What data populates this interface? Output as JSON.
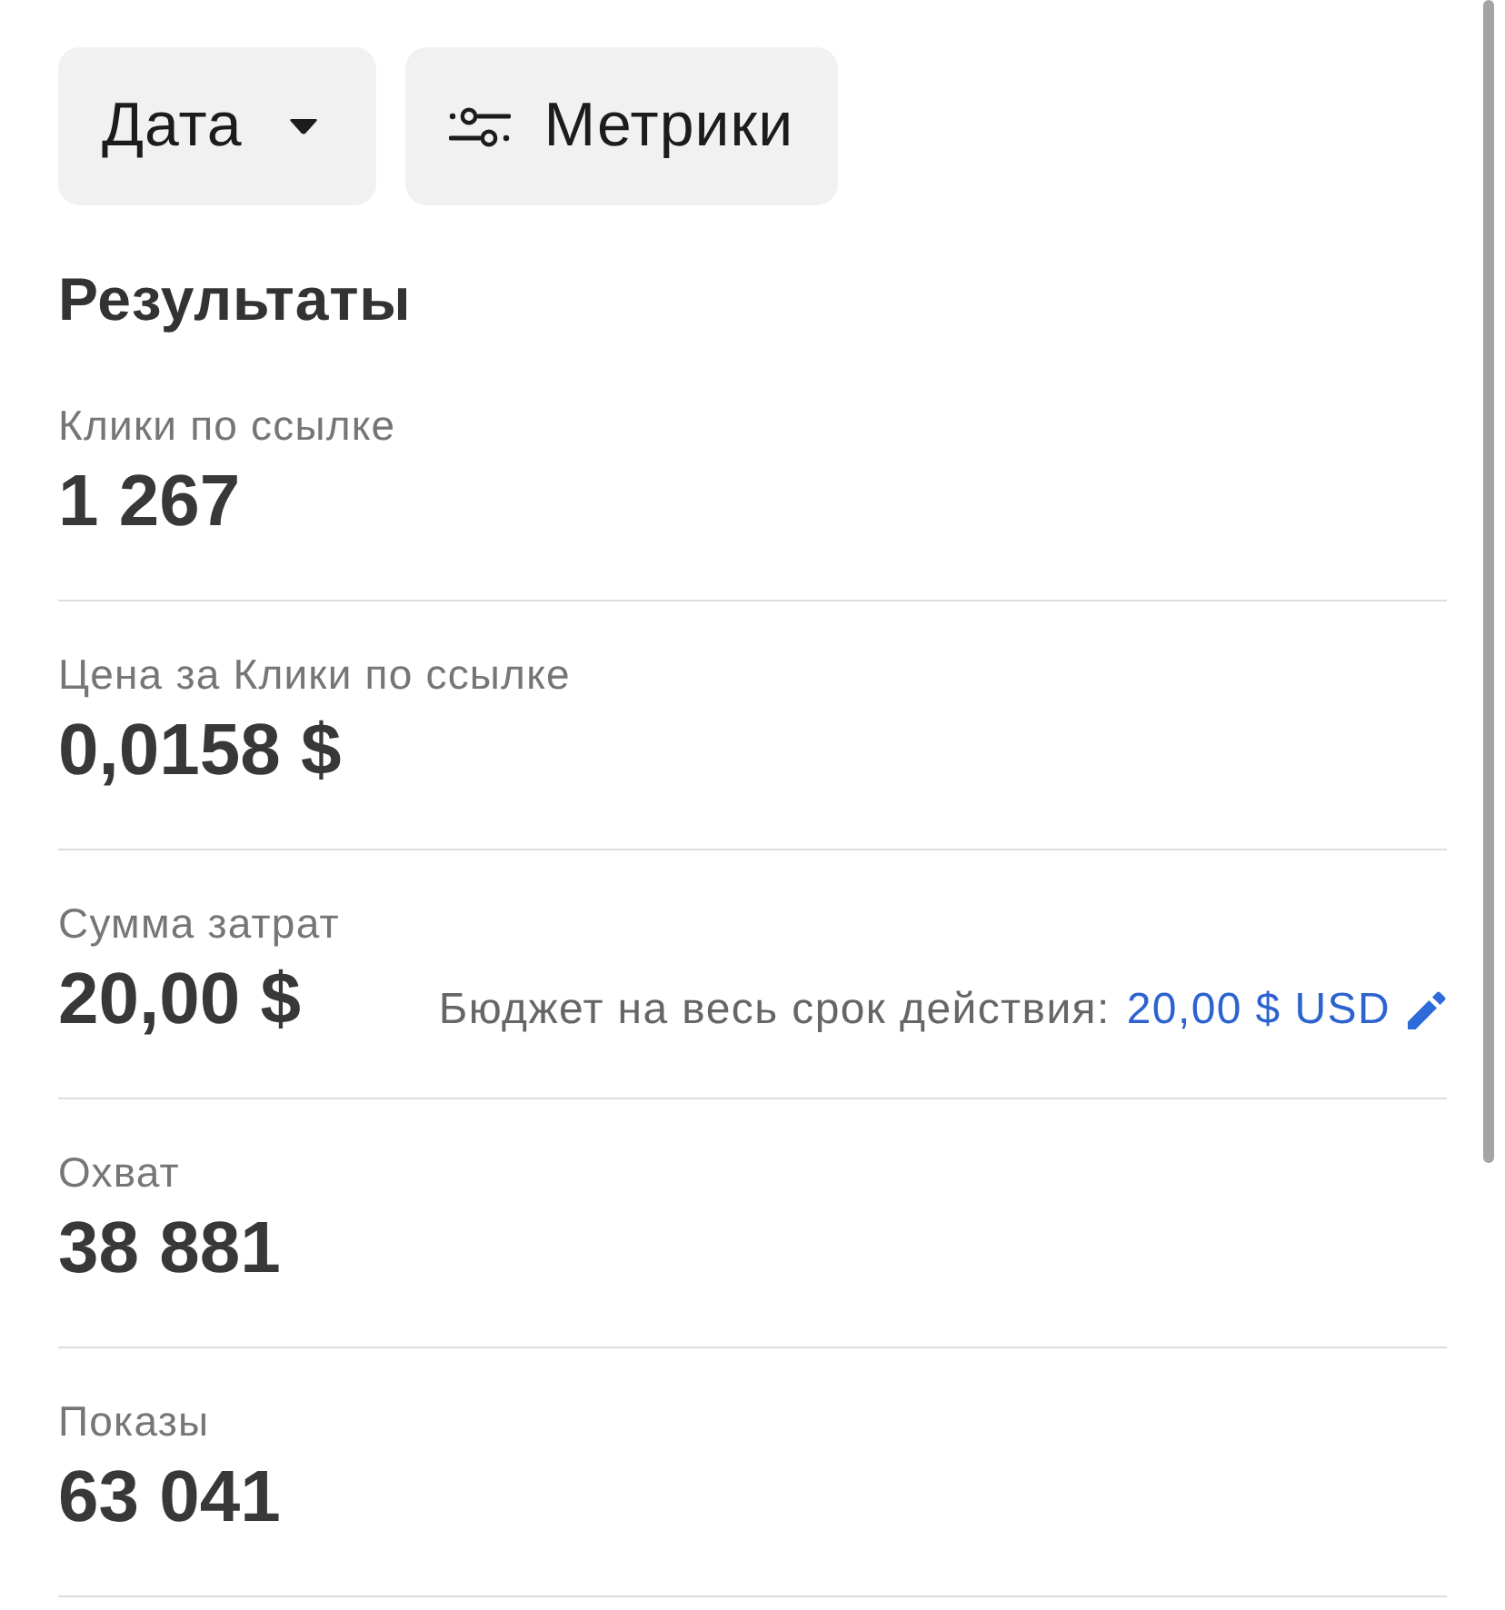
{
  "toolbar": {
    "buttons": [
      {
        "kind": "dropdown",
        "label": "Дата"
      },
      {
        "kind": "filter",
        "label": "Метрики"
      }
    ]
  },
  "results": {
    "title": "Результаты",
    "metrics": [
      {
        "label": "Клики по ссылке",
        "value": "1 267"
      },
      {
        "label": "Цена за Клики по ссылке",
        "value": "0,0158 $"
      },
      {
        "label": "Сумма затрат",
        "value": "20,00 $",
        "budget": {
          "label": "Бюджет на весь срок действия:",
          "link": "20,00 $ USD"
        }
      },
      {
        "label": "Охват",
        "value": "38 881"
      },
      {
        "label": "Показы",
        "value": "63 041"
      }
    ]
  }
}
